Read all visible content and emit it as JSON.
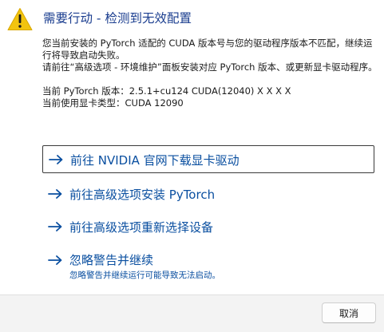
{
  "dialog": {
    "title": "需要行动 - 检测到无效配置",
    "icon": "warning-icon",
    "description": {
      "paragraph1": "您当前安装的 PyTorch 适配的 CUDA 版本号与您的驱动程序版本不匹配，继续运行将导致启动失败。",
      "paragraph2": "请前往“高级选项 - 环境维护”面板安装对应 PyTorch 版本、或更新显卡驱动程序。",
      "torch_version": "当前 PyTorch 版本：2.5.1+cu124 CUDA(12040) X X X X",
      "gpu_type": "当前使用显卡类型：CUDA 12090"
    },
    "commands": [
      {
        "label": "前往 NVIDIA 官网下载显卡驱动",
        "icon": "arrow-right-icon"
      },
      {
        "label": "前往高级选项安装 PyTorch",
        "icon": "arrow-right-icon"
      },
      {
        "label": "前往高级选项重新选择设备",
        "icon": "arrow-right-icon"
      },
      {
        "label": "忽略警告并继续",
        "sub": "忽略警告并继续运行可能导致无法启动。",
        "icon": "arrow-right-icon"
      }
    ],
    "cancel_label": "取消"
  },
  "colors": {
    "title": "#1a3d8f",
    "command_link": "#0a4fa0",
    "warning_fill": "#f2c40f",
    "footer_bg": "#f3f3f3"
  }
}
